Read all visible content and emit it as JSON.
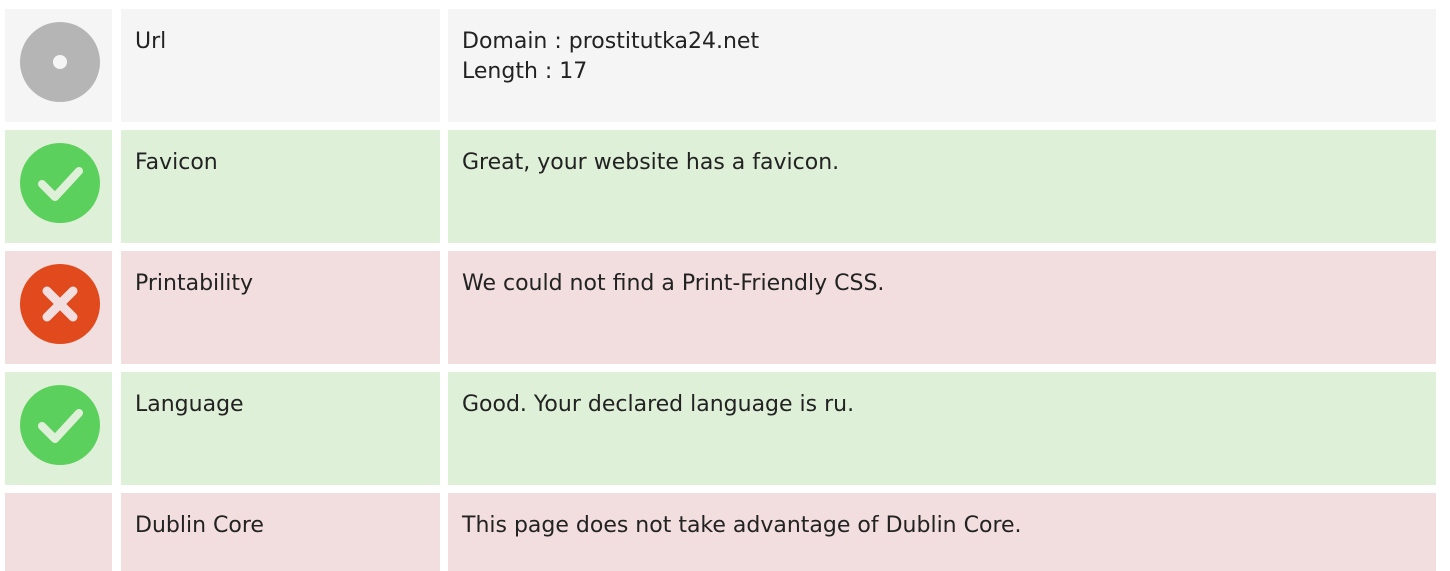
{
  "rows": [
    {
      "status": "neutral",
      "icon": "neutral-disc-icon",
      "label": "Url",
      "lines": [
        "Domain : prostitutka24.net",
        "Length : 17"
      ]
    },
    {
      "status": "good",
      "icon": "check-icon",
      "label": "Favicon",
      "lines": [
        "Great, your website has a favicon."
      ]
    },
    {
      "status": "bad",
      "icon": "cross-icon",
      "label": "Printability",
      "lines": [
        "We could not find a Print-Friendly CSS."
      ]
    },
    {
      "status": "good",
      "icon": "check-icon",
      "label": "Language",
      "lines": [
        "Good. Your declared language is ru."
      ]
    },
    {
      "status": "bad",
      "icon": "",
      "label": "Dublin Core",
      "lines": [
        "This page does not take advantage of Dublin Core."
      ]
    }
  ],
  "colors": {
    "neutral_bg": "#f5f5f5",
    "good_bg": "#dff0d8",
    "bad_bg": "#f2dede",
    "check_green": "#5cd05c",
    "cross_red": "#e04a1c",
    "neutral_gray": "#b5b5b5"
  }
}
